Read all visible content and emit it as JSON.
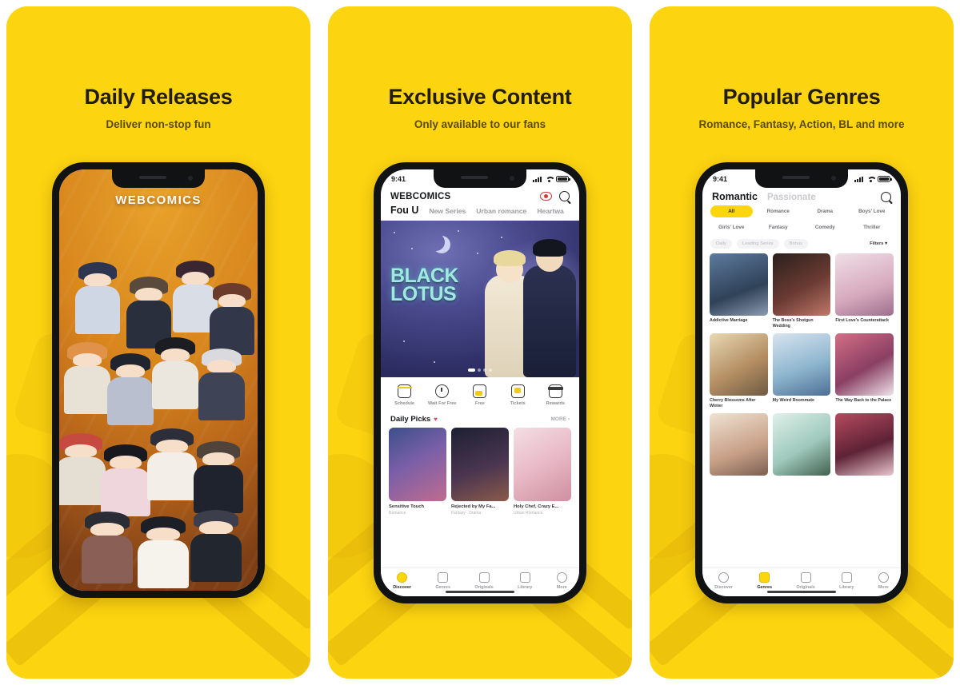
{
  "theme": {
    "panel_bg": "#fcd410",
    "accent": "#fbd60d",
    "heading_color": "#241d06",
    "sub_color": "#5a4a10"
  },
  "panels": [
    {
      "id": "daily-releases",
      "headline": "Daily Releases",
      "subline": "Deliver non-stop fun",
      "phone": {
        "type": "cover",
        "logo": "WEBCOMICS"
      }
    },
    {
      "id": "exclusive-content",
      "headline": "Exclusive Content",
      "subline": "Only available to our fans",
      "phone": {
        "type": "discover",
        "status": {
          "time": "9:41"
        },
        "brand": "WEBCOMICS",
        "icons": [
          "eye-icon",
          "search-icon"
        ],
        "tabs": [
          {
            "label": "Fou U",
            "active": true
          },
          {
            "label": "New Series",
            "active": false
          },
          {
            "label": "Urban romance",
            "active": false
          },
          {
            "label": "Heartwa",
            "active": false
          }
        ],
        "hero": {
          "title_line1": "BLACK",
          "title_line2": "LOTUS"
        },
        "quick_actions": [
          {
            "label": "Schedule",
            "icon": "calendar-icon"
          },
          {
            "label": "Wait For Free",
            "icon": "clock-icon"
          },
          {
            "label": "Free",
            "icon": "free-icon"
          },
          {
            "label": "Tickets",
            "icon": "ticket-icon"
          },
          {
            "label": "Rewards",
            "icon": "gift-icon"
          }
        ],
        "section": {
          "title": "Daily Picks",
          "heart": "♥",
          "more": "MORE ›"
        },
        "picks": [
          {
            "title": "Sensitive Touch",
            "sub": "Romance"
          },
          {
            "title": "Rejected by My Fa...",
            "sub": "Fantasy · Drama"
          },
          {
            "title": "Holy Chef, Crazy E...",
            "sub": "Urban Romance"
          }
        ],
        "tabbar": [
          {
            "label": "Discover",
            "active": true
          },
          {
            "label": "Genres",
            "active": false
          },
          {
            "label": "Originals",
            "active": false
          },
          {
            "label": "Library",
            "active": false
          },
          {
            "label": "More",
            "active": false
          }
        ]
      }
    },
    {
      "id": "popular-genres",
      "headline": "Popular Genres",
      "subline": "Romance, Fantasy, Action, BL and more",
      "phone": {
        "type": "genres",
        "status": {
          "time": "9:41"
        },
        "top_tabs": [
          {
            "label": "Romantic",
            "active": true
          },
          {
            "label": "Passionate",
            "active": false
          }
        ],
        "search_icon": "search-icon",
        "chips_row1": [
          {
            "label": "All",
            "active": true
          },
          {
            "label": "Romance",
            "active": false
          },
          {
            "label": "Drama",
            "active": false
          },
          {
            "label": "Boys' Love",
            "active": false
          }
        ],
        "chips_row2": [
          {
            "label": "Girls' Love",
            "active": false
          },
          {
            "label": "Fantasy",
            "active": false
          },
          {
            "label": "Comedy",
            "active": false
          },
          {
            "label": "Thriller",
            "active": false
          }
        ],
        "subfilters": [
          "Daily",
          "Leading Series",
          "Bonus"
        ],
        "filters_label": "Filters ▾",
        "grid": [
          {
            "title": "Addictive Marriage"
          },
          {
            "title": "The Boss's Shotgun Wedding"
          },
          {
            "title": "First Love's Counterattack"
          },
          {
            "title": "Cherry Blossoms After Winter"
          },
          {
            "title": "My Weird Roommate"
          },
          {
            "title": "The Way Back to the Palace"
          },
          {
            "title": ""
          },
          {
            "title": ""
          },
          {
            "title": ""
          }
        ],
        "tabbar": [
          {
            "label": "Discover",
            "active": false
          },
          {
            "label": "Genres",
            "active": true
          },
          {
            "label": "Originals",
            "active": false
          },
          {
            "label": "Library",
            "active": false
          },
          {
            "label": "More",
            "active": false
          }
        ]
      }
    }
  ]
}
